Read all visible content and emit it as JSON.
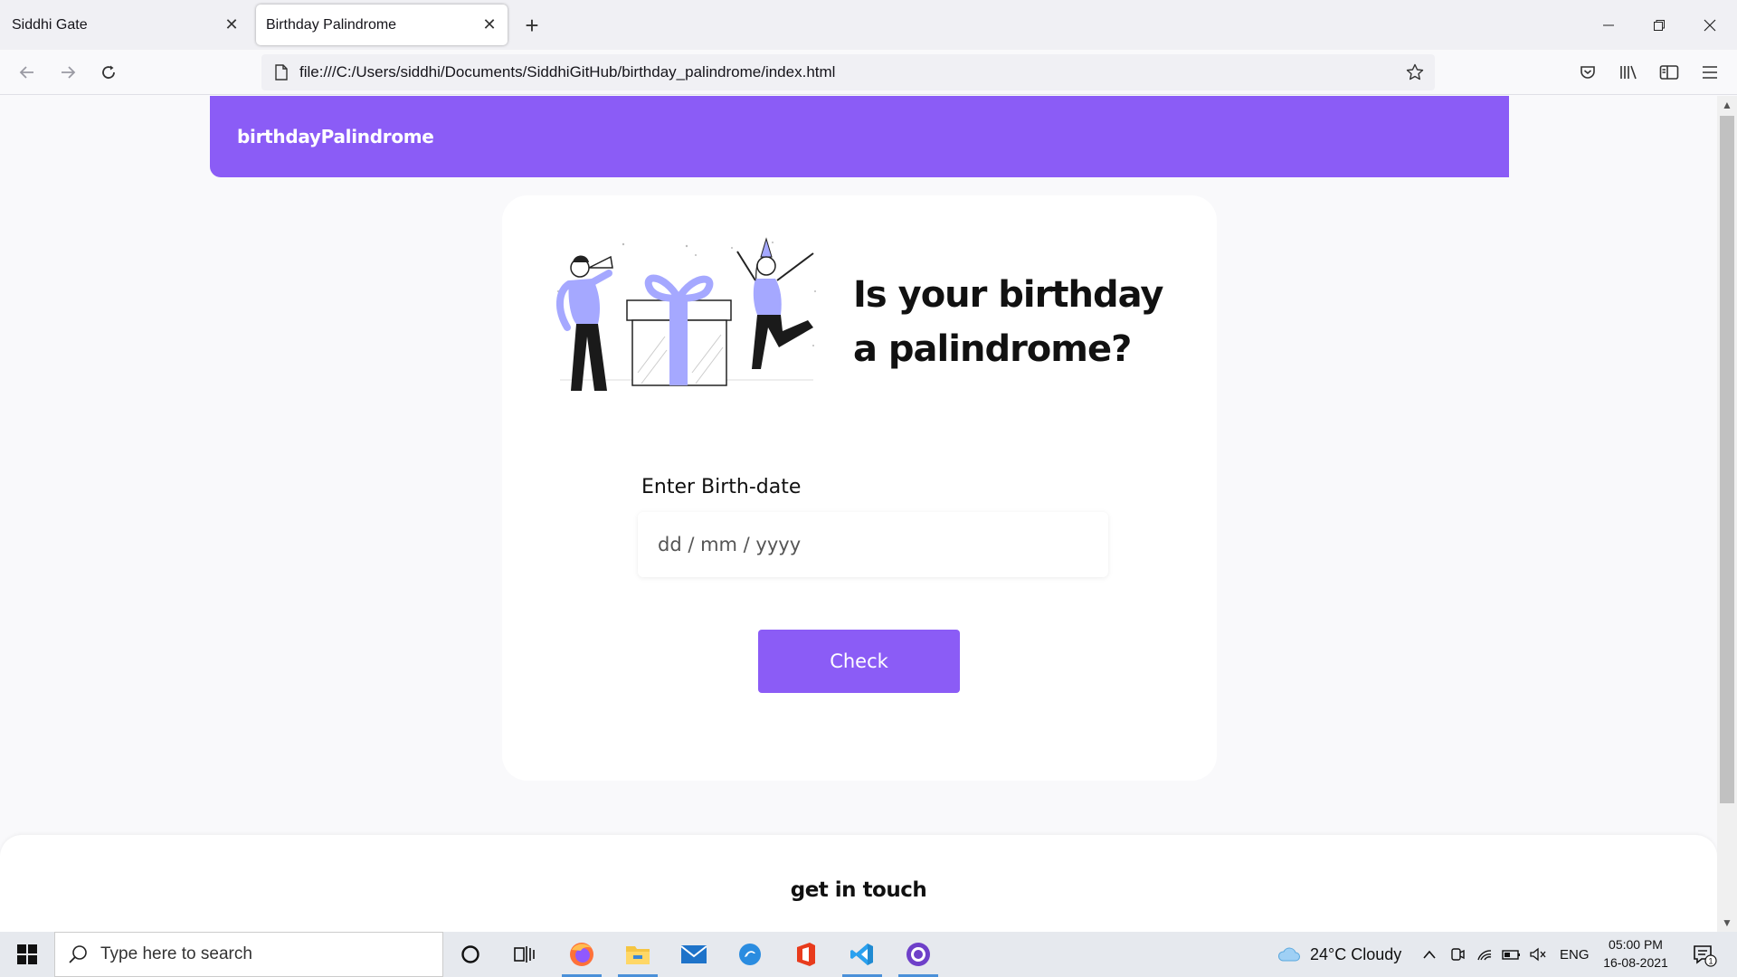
{
  "browser": {
    "tabs": [
      {
        "label": "Siddhi Gate",
        "active": false
      },
      {
        "label": "Birthday Palindrome",
        "active": true
      }
    ],
    "url": "file:///C:/Users/siddhi/Documents/SiddhiGitHub/birthday_palindrome/index.html",
    "icons": {
      "back": "arrow-left-icon",
      "forward": "arrow-right-icon",
      "reload": "reload-icon",
      "bookmark": "star-icon",
      "pocket": "pocket-icon",
      "library": "library-icon",
      "sidebar": "sidebar-icon",
      "menu": "hamburger-menu-icon"
    }
  },
  "site": {
    "brand": "birthdayPalindrome",
    "accent_color": "#8b5cf6",
    "hero_title": "Is your birthday a palindrome?",
    "form": {
      "label": "Enter Birth-date",
      "placeholder": "dd / mm / yyyy",
      "value": "",
      "button_label": "Check"
    },
    "footer_title": "get in touch"
  },
  "taskbar": {
    "search_placeholder": "Type here to search",
    "weather": "24°C  Cloudy",
    "language": "ENG",
    "time": "05:00 PM",
    "date": "16-08-2021",
    "notification_count": "1",
    "apps": [
      "cortana-icon",
      "task-view-icon",
      "firefox-icon",
      "file-explorer-icon",
      "mail-icon",
      "edge-icon",
      "office-icon",
      "vscode-icon",
      "github-desktop-icon"
    ]
  }
}
